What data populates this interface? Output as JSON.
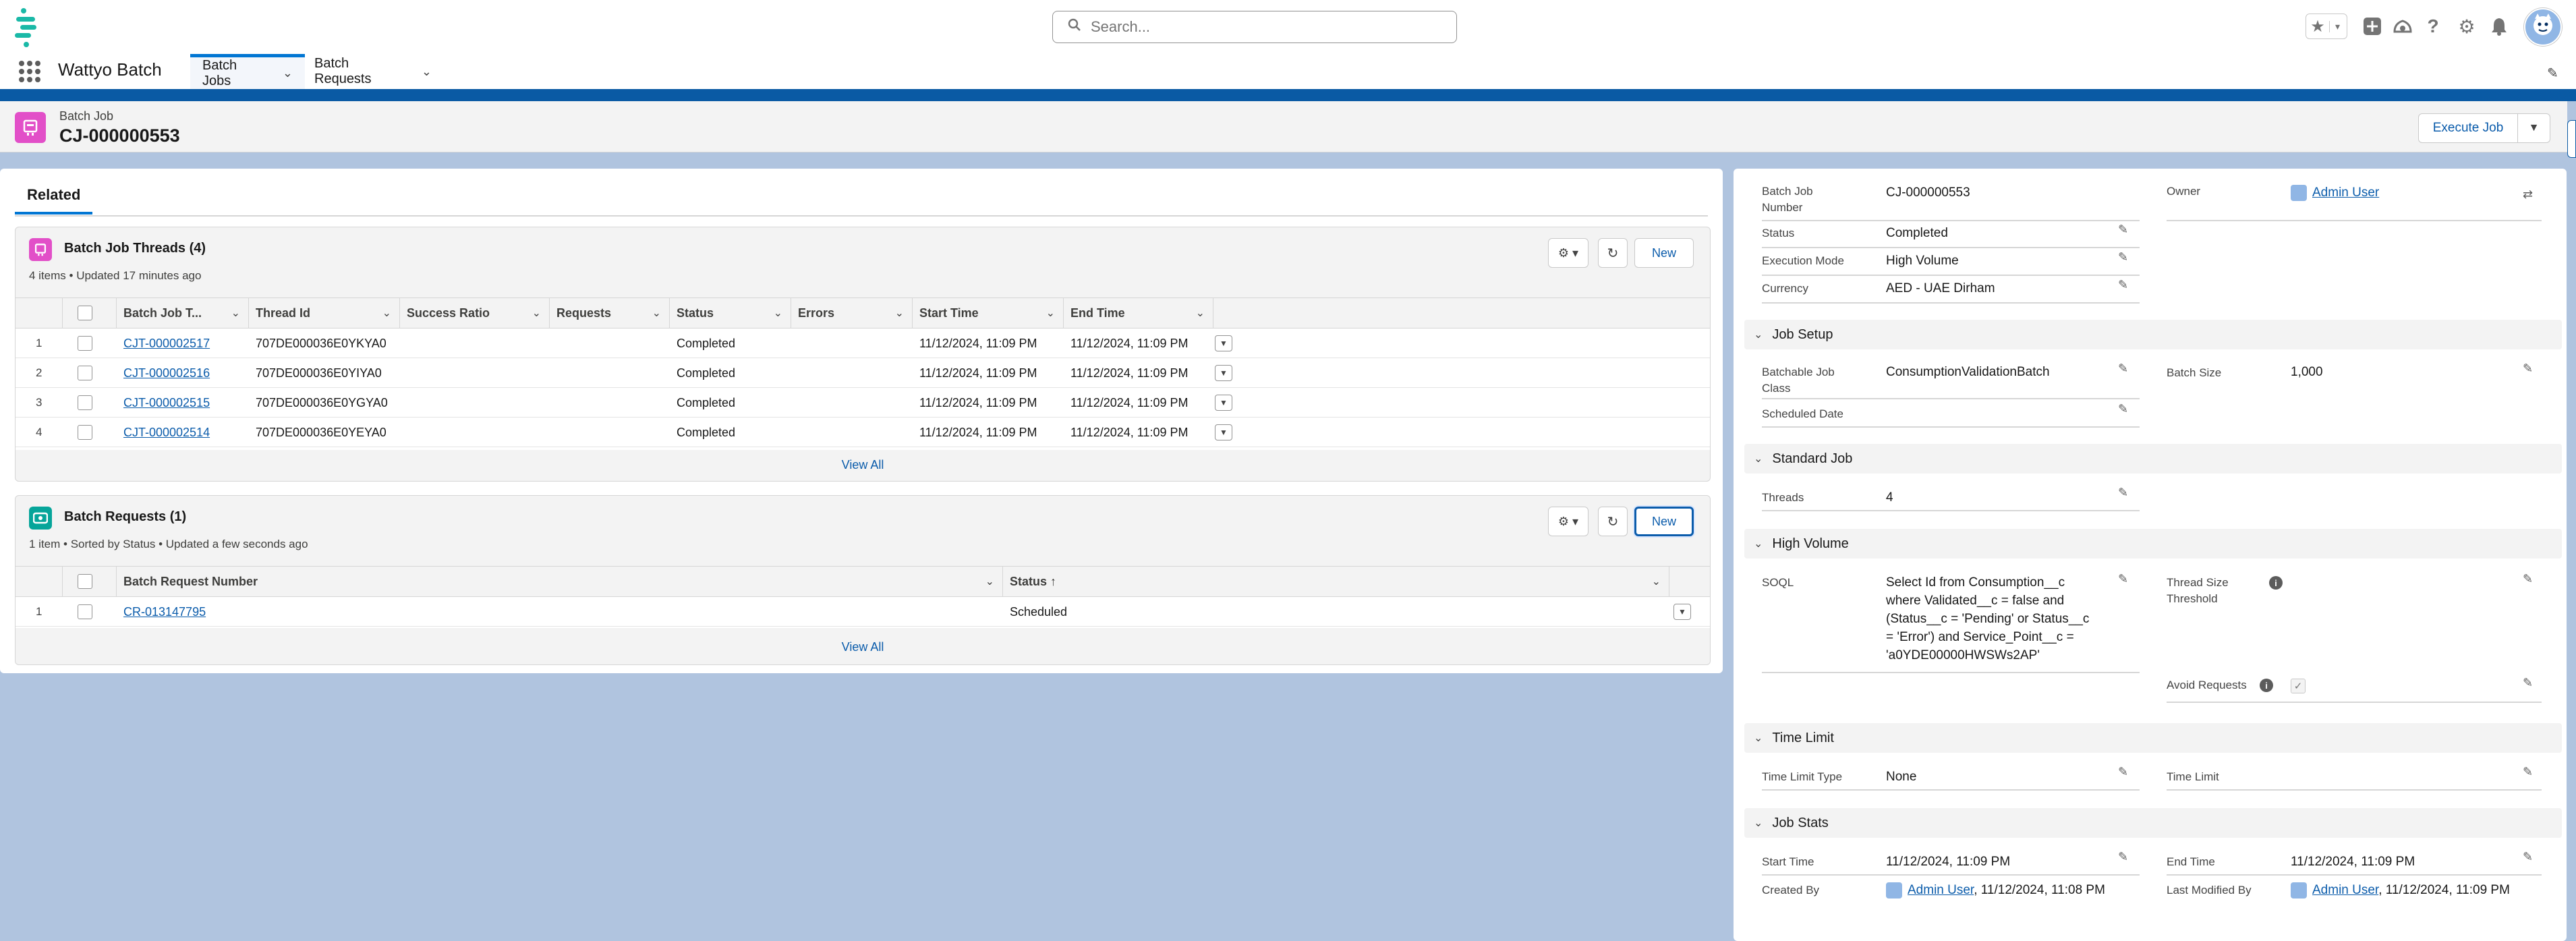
{
  "app": {
    "name": "Wattyo Batch",
    "search_placeholder": "Search...",
    "tabs": [
      {
        "label": "Batch Jobs",
        "active": true
      },
      {
        "label": "Batch Requests",
        "active": false
      }
    ]
  },
  "record": {
    "type_label": "Batch Job",
    "name": "CJ-000000553",
    "execute_label": "Execute Job"
  },
  "related": {
    "tab_label": "Related",
    "threads": {
      "title": "Batch Job Threads (4)",
      "subtitle": "4 items • Updated 17 minutes ago",
      "new_label": "New",
      "columns": [
        "Batch Job T...",
        "Thread Id",
        "Success Ratio",
        "Requests",
        "Status",
        "Errors",
        "Start Time",
        "End Time"
      ],
      "rows": [
        {
          "num": "1",
          "name": "CJT-000002517",
          "thread_id": "707DE000036E0YKYA0",
          "success_ratio": "",
          "requests": "",
          "status": "Completed",
          "errors": "",
          "start": "11/12/2024, 11:09 PM",
          "end": "11/12/2024, 11:09 PM"
        },
        {
          "num": "2",
          "name": "CJT-000002516",
          "thread_id": "707DE000036E0YIYA0",
          "success_ratio": "",
          "requests": "",
          "status": "Completed",
          "errors": "",
          "start": "11/12/2024, 11:09 PM",
          "end": "11/12/2024, 11:09 PM"
        },
        {
          "num": "3",
          "name": "CJT-000002515",
          "thread_id": "707DE000036E0YGYA0",
          "success_ratio": "",
          "requests": "",
          "status": "Completed",
          "errors": "",
          "start": "11/12/2024, 11:09 PM",
          "end": "11/12/2024, 11:09 PM"
        },
        {
          "num": "4",
          "name": "CJT-000002514",
          "thread_id": "707DE000036E0YEYA0",
          "success_ratio": "",
          "requests": "",
          "status": "Completed",
          "errors": "",
          "start": "11/12/2024, 11:09 PM",
          "end": "11/12/2024, 11:09 PM"
        }
      ],
      "view_all": "View All"
    },
    "requests": {
      "title": "Batch Requests (1)",
      "subtitle": "1 item • Sorted by Status • Updated a few seconds ago",
      "new_label": "New",
      "columns": [
        "Batch Request Number",
        "Status"
      ],
      "rows": [
        {
          "num": "1",
          "number": "CR-013147795",
          "status": "Scheduled"
        }
      ],
      "view_all": "View All"
    }
  },
  "details": {
    "job_number_label": "Batch Job Number",
    "job_number": "CJ-000000553",
    "owner_label": "Owner",
    "owner": "Admin User",
    "status_label": "Status",
    "status": "Completed",
    "exec_mode_label": "Execution Mode",
    "exec_mode": "High Volume",
    "currency_label": "Currency",
    "currency": "AED - UAE Dirham",
    "sections": {
      "job_setup": "Job Setup",
      "standard_job": "Standard Job",
      "high_volume": "High Volume",
      "time_limit": "Time Limit",
      "job_stats": "Job Stats"
    },
    "batchable_class_label": "Batchable Job Class",
    "batchable_class": "ConsumptionValidationBatch",
    "batch_size_label": "Batch Size",
    "batch_size": "1,000",
    "scheduled_date_label": "Scheduled Date",
    "threads_label": "Threads",
    "threads": "4",
    "soql_label": "SOQL",
    "soql_lines": [
      "Select Id from Consumption__c",
      "where Validated__c = false and",
      "(Status__c = 'Pending' or Status__c",
      "= 'Error') and Service_Point__c =",
      "'a0YDE00000HWSWs2AP'"
    ],
    "thread_size_label_1": "Thread Size",
    "thread_size_label_2": "Threshold",
    "avoid_requests_label": "Avoid Requests",
    "avoid_requests_checked": true,
    "time_limit_type_label": "Time Limit Type",
    "time_limit_type": "None",
    "time_limit_label": "Time Limit",
    "start_time_label": "Start Time",
    "start_time": "11/12/2024, 11:09 PM",
    "end_time_label": "End Time",
    "end_time": "11/12/2024, 11:09 PM",
    "created_by_label": "Created By",
    "created_by_user": "Admin User",
    "created_by_date": ", 11/12/2024, 11:08 PM",
    "modified_by_label": "Last Modified By",
    "modified_by_user": "Admin User",
    "modified_by_date": ", 11/12/2024, 11:09 PM"
  },
  "colors": {
    "brand_blue": "#0176d3",
    "link": "#0b5cab",
    "batch_job_icon": "#e24fc8",
    "request_icon": "#06a59a",
    "background": "#b0c4df"
  }
}
